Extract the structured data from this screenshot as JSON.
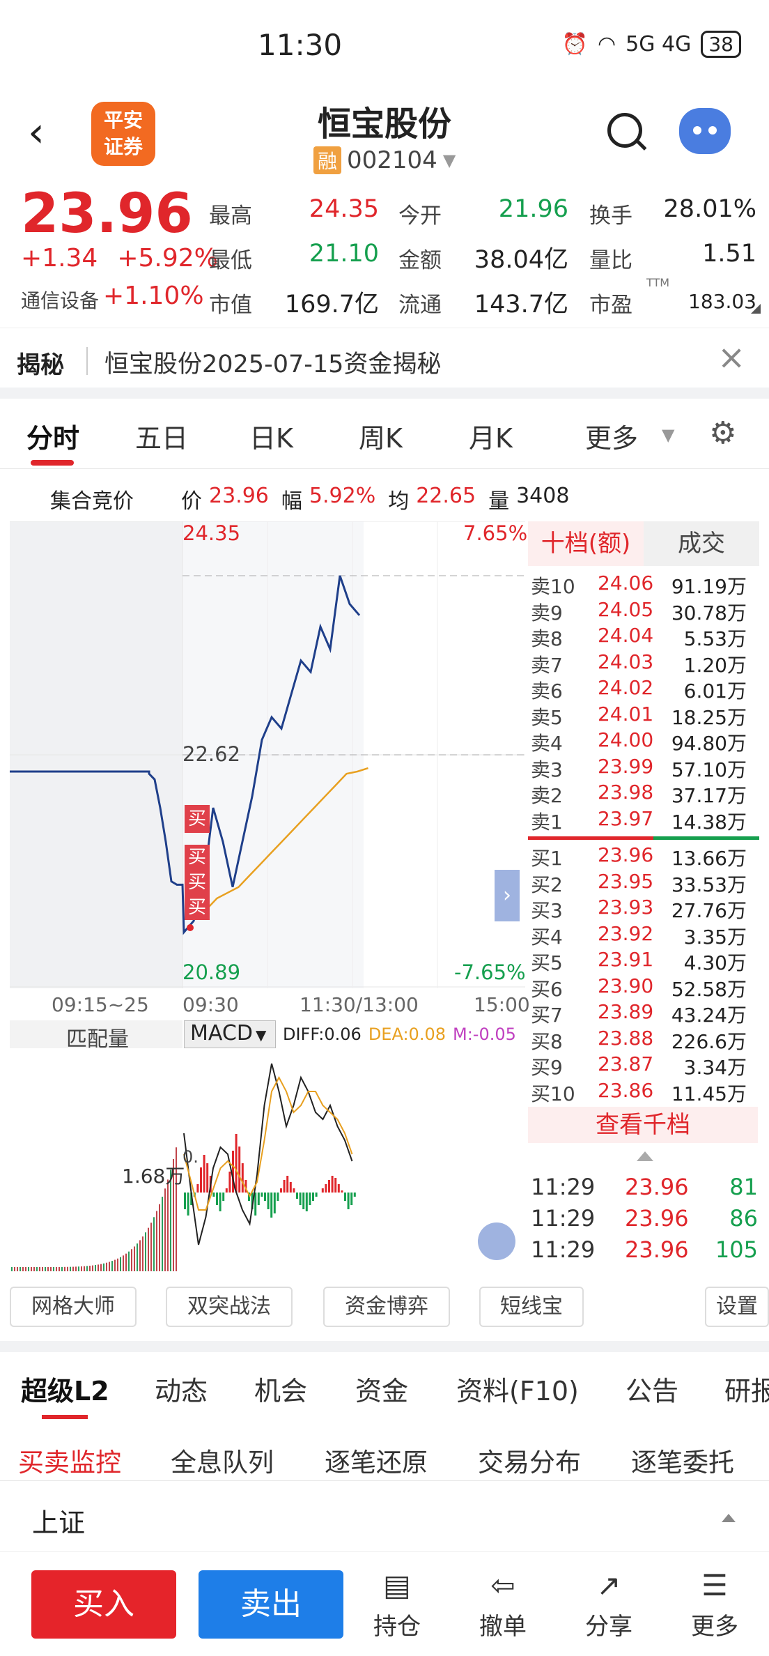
{
  "status": {
    "time": "11:30",
    "network": "5G 4G",
    "battery": "38"
  },
  "header": {
    "logo_line1": "平安",
    "logo_line2": "证券",
    "name": "恒宝股份",
    "tag": "融",
    "code": "002104"
  },
  "quote": {
    "price": "23.96",
    "change": "+1.34",
    "change_pct": "+5.92%",
    "sector": "通信设备",
    "sector_change": "+1.10%",
    "fields": [
      {
        "label": "最高",
        "value": "24.35",
        "color": "red"
      },
      {
        "label": "今开",
        "value": "21.96",
        "color": "green"
      },
      {
        "label": "换手",
        "value": "28.01%",
        "color": "black"
      },
      {
        "label": "最低",
        "value": "21.10",
        "color": "green"
      },
      {
        "label": "金额",
        "value": "38.04亿",
        "color": "black"
      },
      {
        "label": "量比",
        "value": "1.51",
        "color": "black"
      },
      {
        "label": "市值",
        "value": "169.7亿",
        "color": "black"
      },
      {
        "label": "流通",
        "value": "143.7亿",
        "color": "black"
      },
      {
        "label": "市盈",
        "value": "183.03",
        "color": "black"
      }
    ],
    "pe_sup": "TTM"
  },
  "banner": {
    "tag": "揭秘",
    "text": "恒宝股份2025-07-15资金揭秘"
  },
  "ktabs": [
    "分时",
    "五日",
    "日K",
    "周K",
    "月K",
    "更多"
  ],
  "auction": {
    "label": "集合竞价",
    "price_label": "价",
    "price": "23.96",
    "amp_label": "幅",
    "amp": "5.92%",
    "avg_label": "均",
    "avg": "22.65",
    "vol_label": "量",
    "vol": "3408"
  },
  "chart_labels": {
    "high": "24.35",
    "mid": "22.62",
    "low": "20.89",
    "high_pct": "7.65%",
    "low_pct": "-7.65%",
    "t1": "09:15~25",
    "t2": "09:30",
    "t3": "11:30/13:00",
    "t4": "15:00",
    "buy_marker": "买"
  },
  "chart_data": {
    "type": "line",
    "xlabel": "",
    "ylabel": "",
    "ylim": [
      20.89,
      24.35
    ],
    "series": [
      {
        "values": [
          22.62,
          22.62,
          22.62,
          22.62,
          22.62,
          22.62,
          22.6,
          22.55,
          22.3,
          22.0,
          21.65,
          21.62,
          21.62,
          21.2,
          21.3,
          21.6,
          22.3,
          22.0,
          21.6,
          22.0,
          22.4,
          22.9,
          23.1,
          23.0,
          23.3,
          23.6,
          23.5,
          23.9,
          23.7,
          24.35,
          24.1,
          24.0
        ]
      },
      {
        "values": [
          21.4,
          21.5,
          21.55,
          21.6,
          21.7,
          21.8,
          21.9,
          22.0,
          22.1,
          22.2,
          22.3,
          22.4,
          22.5,
          22.6,
          22.62,
          22.65
        ]
      }
    ]
  },
  "orderbook": {
    "tabs": [
      "十档(额)",
      "成交"
    ],
    "asks": [
      {
        "label": "卖10",
        "price": "24.06",
        "vol": "91.19万"
      },
      {
        "label": "卖9",
        "price": "24.05",
        "vol": "30.78万"
      },
      {
        "label": "卖8",
        "price": "24.04",
        "vol": "5.53万"
      },
      {
        "label": "卖7",
        "price": "24.03",
        "vol": "1.20万"
      },
      {
        "label": "卖6",
        "price": "24.02",
        "vol": "6.01万"
      },
      {
        "label": "卖5",
        "price": "24.01",
        "vol": "18.25万"
      },
      {
        "label": "卖4",
        "price": "24.00",
        "vol": "94.80万"
      },
      {
        "label": "卖3",
        "price": "23.99",
        "vol": "57.10万"
      },
      {
        "label": "卖2",
        "price": "23.98",
        "vol": "37.17万"
      },
      {
        "label": "卖1",
        "price": "23.97",
        "vol": "14.38万"
      }
    ],
    "bids": [
      {
        "label": "买1",
        "price": "23.96",
        "vol": "13.66万"
      },
      {
        "label": "买2",
        "price": "23.95",
        "vol": "33.53万"
      },
      {
        "label": "买3",
        "price": "23.93",
        "vol": "27.76万"
      },
      {
        "label": "买4",
        "price": "23.92",
        "vol": "3.35万"
      },
      {
        "label": "买5",
        "price": "23.91",
        "vol": "4.30万"
      },
      {
        "label": "买6",
        "price": "23.90",
        "vol": "52.58万"
      },
      {
        "label": "买7",
        "price": "23.89",
        "vol": "43.24万"
      },
      {
        "label": "买8",
        "price": "23.88",
        "vol": "226.6万"
      },
      {
        "label": "买9",
        "price": "23.87",
        "vol": "3.34万"
      },
      {
        "label": "买10",
        "price": "23.86",
        "vol": "11.45万"
      }
    ],
    "more": "查看千档",
    "trades": [
      {
        "time": "11:29",
        "price": "23.96",
        "vol": "81"
      },
      {
        "time": "11:29",
        "price": "23.96",
        "vol": "86"
      },
      {
        "time": "11:29",
        "price": "23.96",
        "vol": "105"
      }
    ]
  },
  "indicator": {
    "left_label": "匹配量",
    "vol_label": "1.68万",
    "name": "MACD",
    "diff": "DIFF:0.06",
    "dea": "DEA:0.08",
    "m": "M:-0.05",
    "zero": "0."
  },
  "tools": [
    "网格大师",
    "双突战法",
    "资金博弈",
    "短线宝",
    "设置"
  ],
  "ftabs": [
    "超级L2",
    "动态",
    "机会",
    "资金",
    "资料(F10)",
    "公告",
    "研报"
  ],
  "subtabs": [
    "买卖监控",
    "全息队列",
    "逐笔还原",
    "交易分布",
    "逐笔委托"
  ],
  "market": "上证",
  "bottom": {
    "buy": "买入",
    "sell": "卖出",
    "nav": [
      "持仓",
      "撤单",
      "分享",
      "更多"
    ]
  },
  "colors": {
    "red": "#e0262b",
    "green": "#159f4e",
    "blue": "#1e7ee8",
    "line": "#1f3f8a",
    "avg": "#e8a020"
  }
}
